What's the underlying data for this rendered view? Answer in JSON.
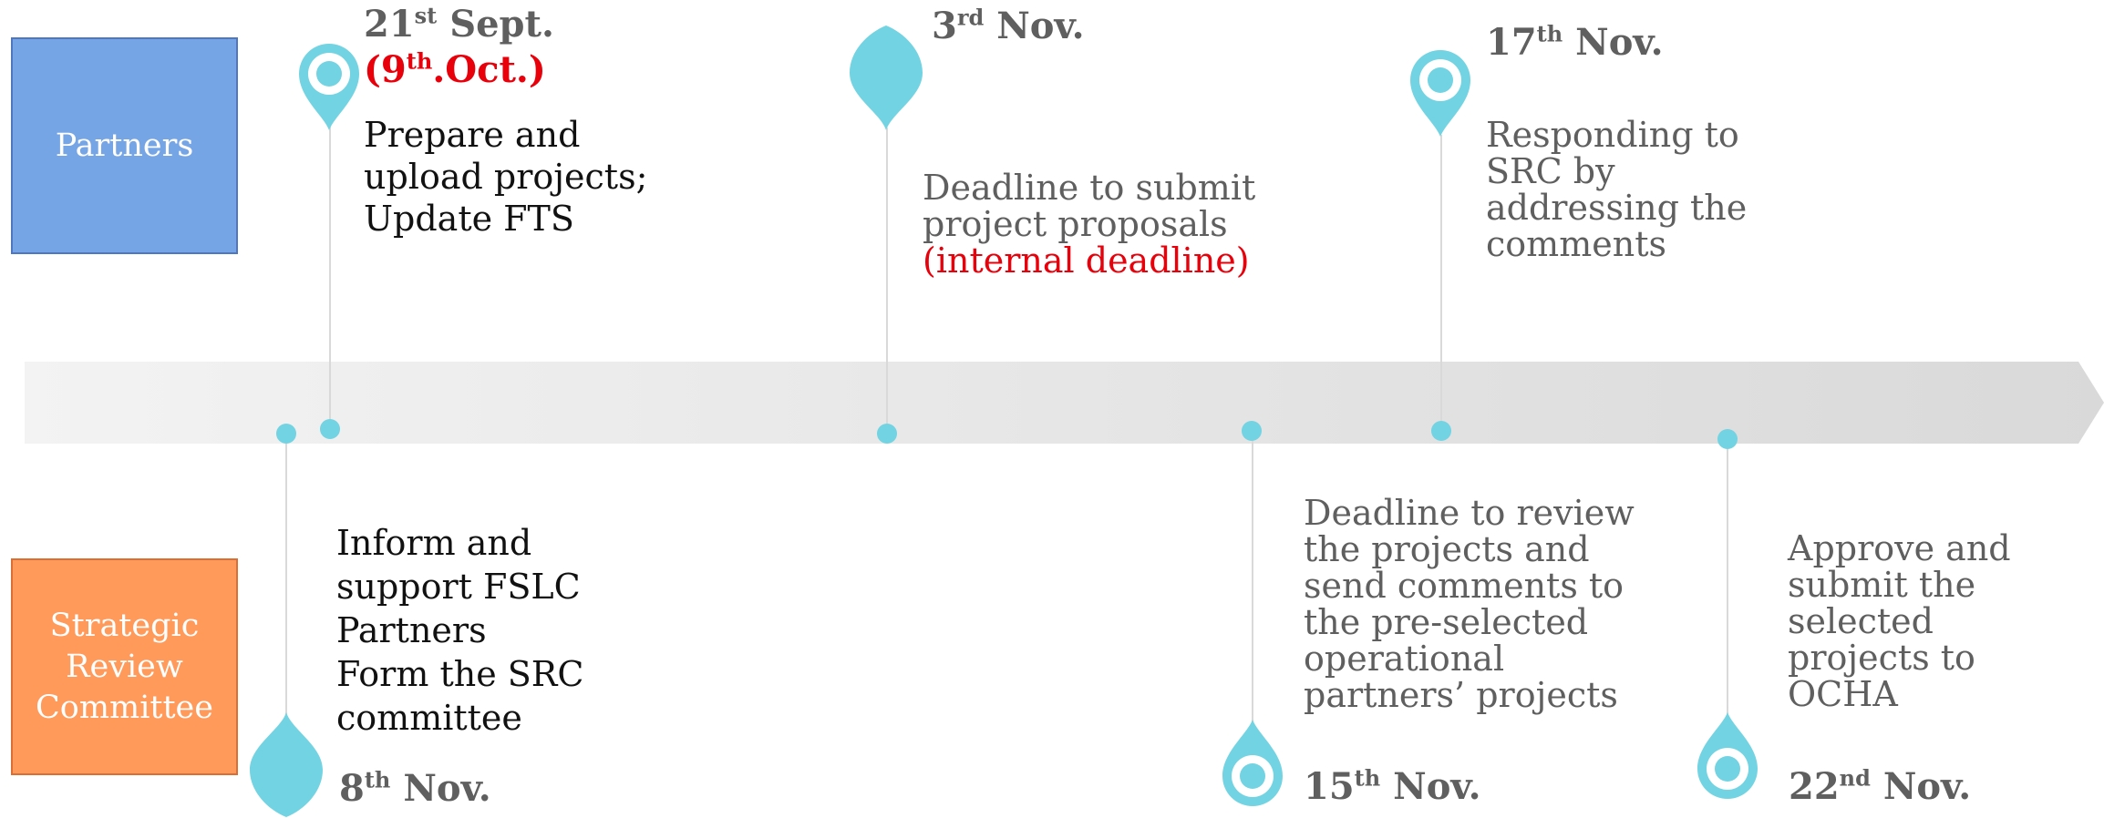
{
  "lanes": {
    "partners": "Partners",
    "src": [
      "Strategic",
      "Review",
      "Committee"
    ]
  },
  "events": {
    "sept21": {
      "date_num": "21",
      "date_sup": "st",
      "date_rest": "Sept.",
      "alt_open": "(9",
      "alt_sup": "th",
      "alt_rest": ".Oct.)",
      "lines": [
        "Prepare and",
        "upload projects;",
        "Update FTS"
      ]
    },
    "nov3": {
      "date_num": "3",
      "date_sup": "rd",
      "date_rest": "Nov.",
      "lines": [
        "Deadline to submit",
        "project proposals"
      ],
      "note": "(internal deadline)"
    },
    "nov17": {
      "date_num": "17",
      "date_sup": "th",
      "date_rest": "Nov.",
      "lines": [
        "Responding to",
        "SRC by",
        "addressing the",
        "comments"
      ]
    },
    "nov8": {
      "date_num": "8",
      "date_sup": "th",
      "date_rest": "Nov.",
      "lines": [
        "Inform and",
        "support FSLC",
        "Partners",
        "Form the SRC",
        "committee"
      ]
    },
    "nov15": {
      "date_num": "15",
      "date_sup": "th",
      "date_rest": "Nov.",
      "lines": [
        "Deadline to review",
        "the projects and",
        "send comments to",
        "the pre-selected",
        "operational",
        "partners’ projects"
      ]
    },
    "nov22": {
      "date_num": "22",
      "date_sup": "nd",
      "date_rest": "Nov.",
      "lines": [
        "Approve and",
        "submit the",
        "selected",
        "projects to",
        "OCHA"
      ]
    }
  },
  "colors": {
    "partners_box": "#76a5e6",
    "src_box": "#ff9a5a",
    "marker": "#72d3e2",
    "highlight": "#e8000b",
    "timeline": "#e6e6e6"
  }
}
